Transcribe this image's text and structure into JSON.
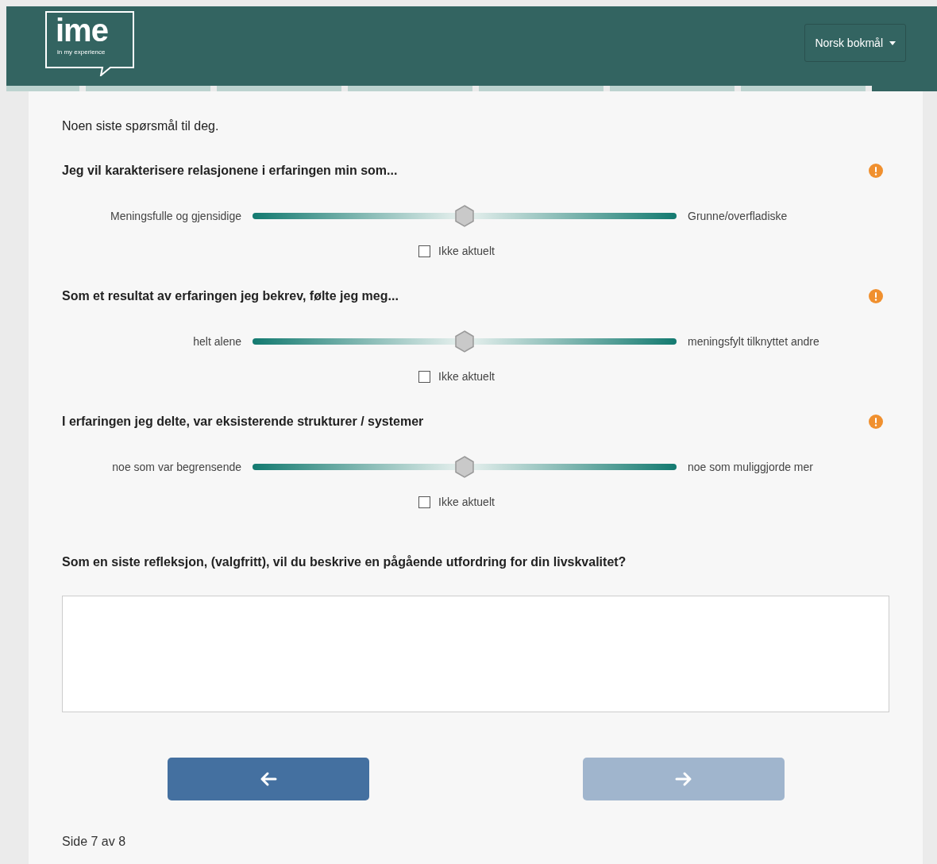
{
  "logo": {
    "mark": "ime",
    "tagline": "in my experience"
  },
  "language_button": {
    "label": "Norsk bokmål"
  },
  "progress": [
    {
      "selected": false
    },
    {
      "selected": false
    },
    {
      "selected": false
    },
    {
      "selected": false
    },
    {
      "selected": false
    },
    {
      "selected": false
    },
    {
      "selected": false
    },
    {
      "selected": true
    }
  ],
  "intro": "Noen siste spørsmål til deg.",
  "questions": [
    {
      "title": "Jeg vil karakterisere relasjonene i erfaringen min som...",
      "left_label": "Meningsfulle og gjensidige",
      "right_label": "Grunne/overfladiske",
      "level": 0.5,
      "not_applicable": {
        "label": "Ikke aktuelt",
        "checked": false
      },
      "required": true
    },
    {
      "title": "Som et resultat av erfaringen jeg bekrev, følte jeg meg...",
      "left_label": "helt alene",
      "right_label": "meningsfylt tilknyttet andre",
      "level": 0.5,
      "not_applicable": {
        "label": "Ikke aktuelt",
        "checked": false
      },
      "required": true
    },
    {
      "title": "I erfaringen jeg delte, var eksisterende strukturer / systemer",
      "left_label": "noe som var begrensende",
      "right_label": "noe som muliggjorde mer",
      "level": 0.5,
      "not_applicable": {
        "label": "Ikke aktuelt",
        "checked": false
      },
      "required": true
    }
  ],
  "reflection": {
    "title": "Som en siste refleksjon, (valgfritt), vil du beskrive en pågående utfordring for din livskvalitet?"
  },
  "nav": {
    "back_disabled": false,
    "next_disabled": true
  },
  "page_indicator": "Side 7 av 8"
}
